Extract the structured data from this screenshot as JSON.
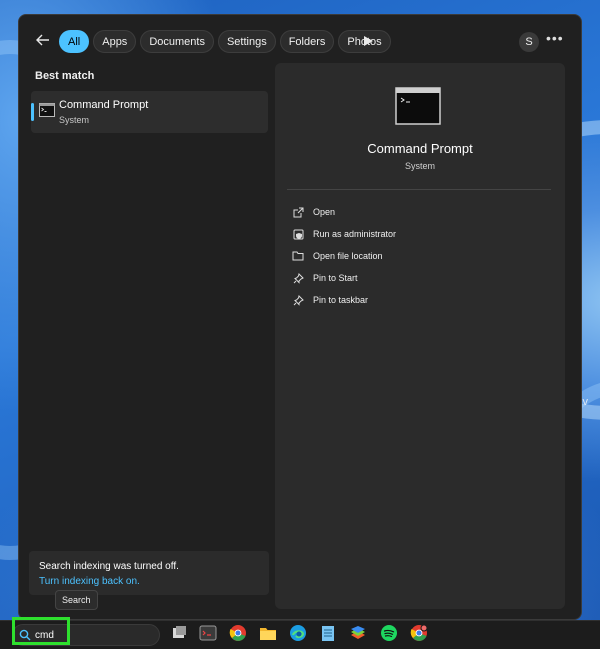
{
  "filters": {
    "items": [
      "All",
      "Apps",
      "Documents",
      "Settings",
      "Folders",
      "Photos"
    ],
    "active": "All"
  },
  "account_initial": "S",
  "best_match": {
    "heading": "Best match",
    "title": "Command Prompt",
    "subtitle": "System"
  },
  "detail": {
    "title": "Command Prompt",
    "subtitle": "System",
    "actions": [
      "Open",
      "Run as administrator",
      "Open file location",
      "Pin to Start",
      "Pin to taskbar"
    ]
  },
  "notice": {
    "message": "Search indexing was turned off.",
    "link": "Turn indexing back on."
  },
  "tooltip": "Search",
  "taskbar": {
    "search_value": "cmd",
    "apps": [
      "task-view-icon",
      "terminal-icon",
      "chrome-icon",
      "file-explorer-icon",
      "edge-icon",
      "notepad-icon",
      "bluestacks-icon",
      "spotify-icon",
      "chrome-alt-icon"
    ]
  },
  "colors": {
    "accent": "#4cc2ff",
    "highlight": "#2ee02e",
    "panel": "#202020"
  }
}
